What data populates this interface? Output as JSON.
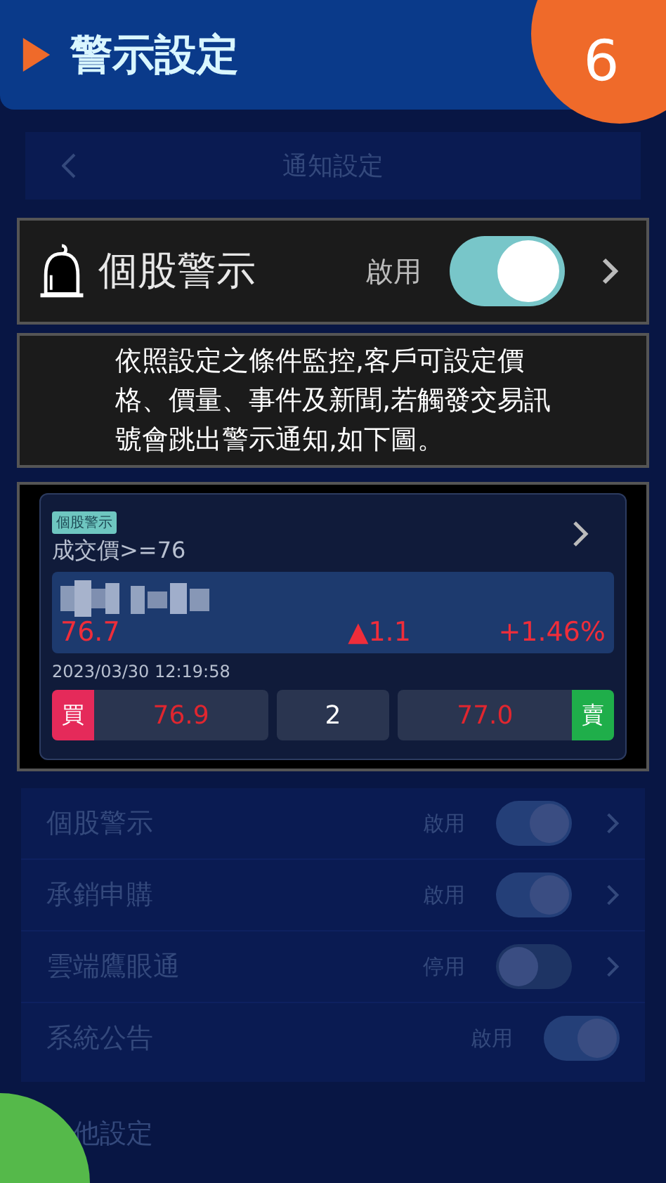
{
  "header": {
    "title": "警示設定",
    "step": "6"
  },
  "nav": {
    "title": "通知設定"
  },
  "featured": {
    "label": "個股警示",
    "status": "啟用",
    "on": true
  },
  "description_lines": [
    "依照設定之條件監控,客戶可設定價",
    "格、價量、事件及新聞,若觸發交易訊",
    "號會跳出警示通知,如下圖。"
  ],
  "alert": {
    "tag": "個股警示",
    "condition": "成交價>=76",
    "price": "76.7",
    "change": "▲1.1",
    "change_pct": "+1.46%",
    "time": "2023/03/30 12:19:58",
    "buy_label": "買",
    "bid": "76.9",
    "quantity": "2",
    "ask": "77.0",
    "sell_label": "賣"
  },
  "settings": [
    {
      "label": "個股警示",
      "status": "啟用",
      "on": true,
      "has_arrow": true
    },
    {
      "label": "承銷申購",
      "status": "啟用",
      "on": true,
      "has_arrow": true
    },
    {
      "label": "雲端鷹眼通",
      "status": "停用",
      "on": false,
      "has_arrow": true
    },
    {
      "label": "系統公告",
      "status": "啟用",
      "on": true,
      "has_arrow": false
    }
  ],
  "section": "他設定"
}
